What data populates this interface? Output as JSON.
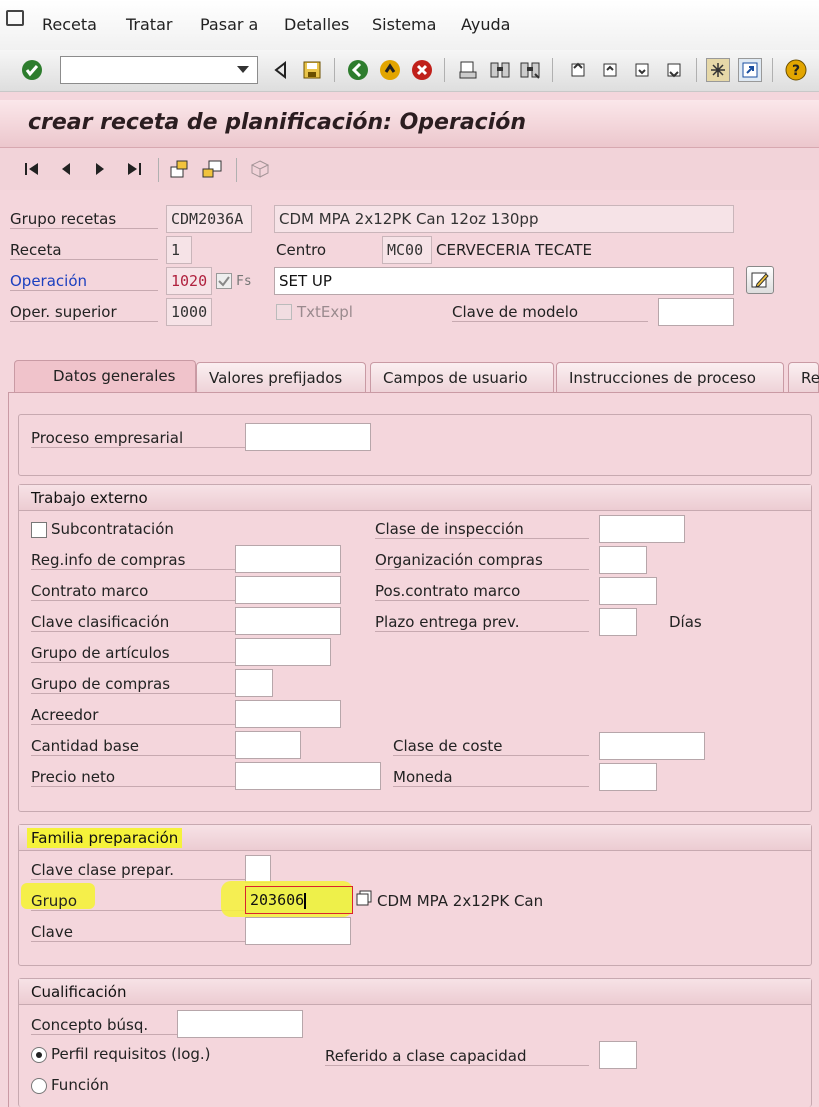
{
  "menu": [
    "Receta",
    "Tratar",
    "Pasar a",
    "Detalles",
    "Sistema",
    "Ayuda"
  ],
  "title": "crear receta de planificación: Operación",
  "header": {
    "grupo_recetas_label": "Grupo recetas",
    "grupo_recetas_value": "CDM2036A",
    "grupo_recetas_desc": "CDM MPA 2x12PK Can 12oz 130pp",
    "receta_label": "Receta",
    "receta_value": "1",
    "centro_label": "Centro",
    "centro_value": "MC00",
    "centro_desc": "CERVECERIA TECATE",
    "operacion_label": "Operación",
    "operacion_value": "1020",
    "fs_label": "Fs",
    "operacion_text": "SET UP",
    "oper_superior_label": "Oper. superior",
    "oper_superior_value": "1000",
    "txtexpl_label": "TxtExpl",
    "clave_modelo_label": "Clave de modelo"
  },
  "tabs": [
    "Datos generales",
    "Valores prefijados",
    "Campos de usuario",
    "Instrucciones de proceso",
    "Re"
  ],
  "proceso": {
    "label": "Proceso empresarial"
  },
  "trabajo_externo": {
    "title": "Trabajo externo",
    "subcontratacion": "Subcontratación",
    "reg_info": "Reg.info de compras",
    "contrato_marco": "Contrato marco",
    "clave_clasificacion": "Clave clasificación",
    "grupo_articulos": "Grupo de artículos",
    "grupo_compras": "Grupo de compras",
    "acreedor": "Acreedor",
    "cantidad_base": "Cantidad base",
    "precio_neto": "Precio neto",
    "clase_inspeccion": "Clase de inspección",
    "organizacion_compras": "Organización compras",
    "pos_contrato": "Pos.contrato marco",
    "plazo_entrega": "Plazo entrega prev.",
    "dias": "Días",
    "clase_coste": "Clase de coste",
    "moneda": "Moneda"
  },
  "familia": {
    "title": "Familia preparación",
    "clave_clase": "Clave clase prepar.",
    "grupo": "Grupo",
    "grupo_value": "203606",
    "grupo_desc": "CDM MPA 2x12PK Can",
    "clave": "Clave"
  },
  "cualificacion": {
    "title": "Cualificación",
    "concepto": "Concepto búsq.",
    "perfil": "Perfil requisitos (log.)",
    "referido": "Referido a clase capacidad",
    "funcion": "Función"
  },
  "colors": {
    "highlight": "#f5f23a",
    "title_bg": "#f0c8cf",
    "link": "#1b3fbf"
  }
}
